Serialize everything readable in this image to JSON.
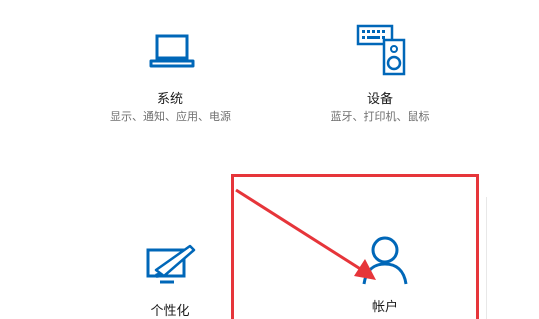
{
  "tiles": [
    {
      "title": "系统",
      "desc": "显示、通知、应用、电源",
      "icon": "laptop-icon"
    },
    {
      "title": "设备",
      "desc": "蓝牙、打印机、鼠标",
      "icon": "keyboard-speaker-icon"
    },
    {
      "title": "个性化",
      "desc": "",
      "icon": "paint-brush-icon"
    },
    {
      "title": "帐户",
      "desc": "",
      "icon": "person-icon"
    }
  ],
  "colors": {
    "accent": "#0067b8",
    "highlight": "#e6353a",
    "arrow": "#e6353a"
  }
}
